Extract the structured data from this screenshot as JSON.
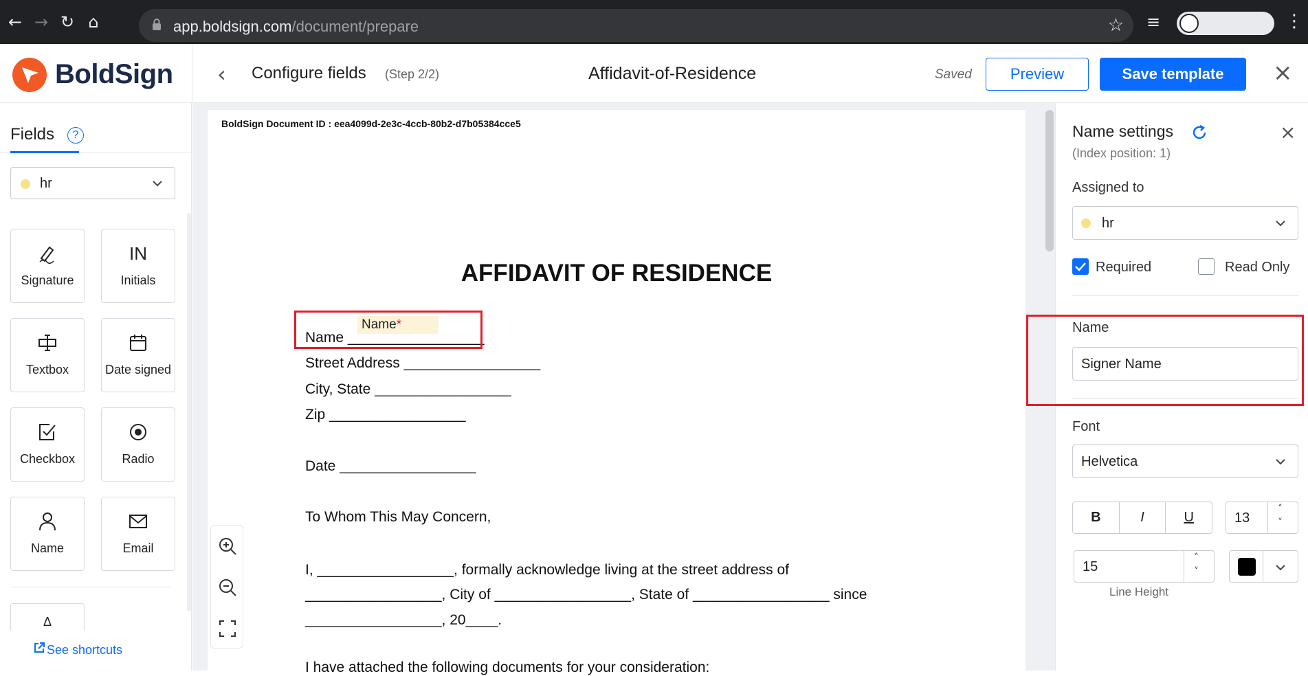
{
  "browser": {
    "url_host": "app.boldsign.com",
    "url_path": "/document/prepare"
  },
  "header": {
    "logo_text": "BoldSign",
    "step_title": "Configure fields",
    "step_sub": "(Step 2/2)",
    "document_title": "Affidavit-of-Residence",
    "saved_label": "Saved",
    "preview_label": "Preview",
    "save_template_label": "Save template"
  },
  "sidebar": {
    "tab_label": "Fields",
    "help_label": "?",
    "signer": "hr",
    "tiles": [
      {
        "label": "Signature",
        "icon": "signature-icon"
      },
      {
        "label": "Initials",
        "icon": "initials-icon",
        "glyph": "IN"
      },
      {
        "label": "Textbox",
        "icon": "textbox-icon"
      },
      {
        "label": "Date signed",
        "icon": "calendar-icon"
      },
      {
        "label": "Checkbox",
        "icon": "checkbox-icon"
      },
      {
        "label": "Radio",
        "icon": "radio-icon"
      },
      {
        "label": "Name",
        "icon": "person-icon"
      },
      {
        "label": "Email",
        "icon": "mail-icon"
      }
    ],
    "shortcuts_label": "See shortcuts"
  },
  "document": {
    "doc_id": "BoldSign Document ID : eea4099d-2e3c-4ccb-80b2-d7b05384cce5",
    "heading": "AFFIDAVIT OF RESIDENCE",
    "lines": [
      "Name _________________",
      "Street Address _________________",
      "City, State _________________",
      "Zip _________________",
      "Date _________________",
      "To Whom This May Concern,",
      "I, _________________, formally acknowledge living at the street address of",
      "_________________, City of _________________, State of _________________ since",
      "_________________, 20____.",
      "I have attached the following documents for your consideration:"
    ],
    "name_field_label": "Name",
    "name_field_required": "*"
  },
  "settings": {
    "title": "Name settings",
    "index": "(Index position: 1)",
    "assigned_label": "Assigned to",
    "assigned_value": "hr",
    "required_label": "Required",
    "required_checked": true,
    "readonly_label": "Read Only",
    "readonly_checked": false,
    "name_label": "Name",
    "name_value": "Signer Name",
    "font_label": "Font",
    "font_value": "Helvetica",
    "bold": "B",
    "italic": "I",
    "underline": "U",
    "font_size": "13",
    "line_height": "15",
    "line_height_label": "Line Height",
    "color": "#000000"
  },
  "colors": {
    "accent": "#0a6cff",
    "highlight": "#e0202a",
    "signer_dot": "#f5e38a"
  }
}
